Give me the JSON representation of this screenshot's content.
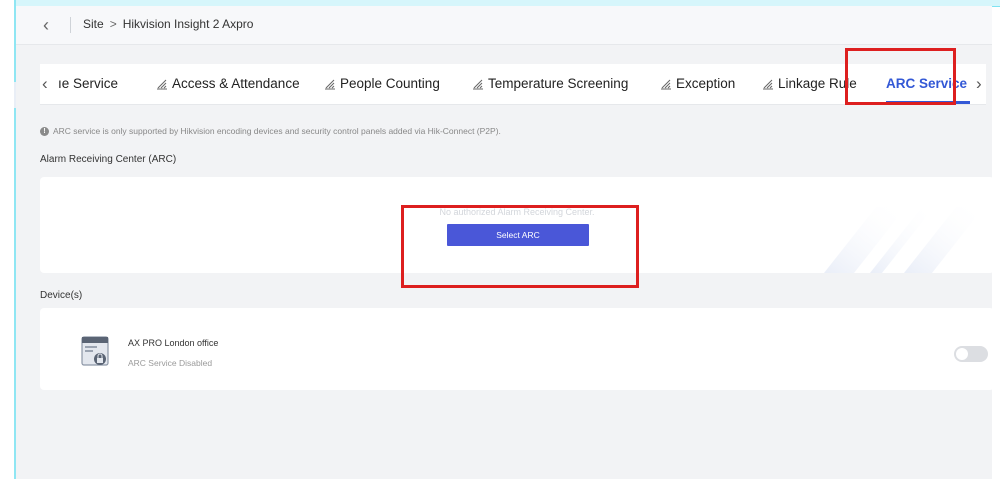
{
  "breadcrumb": {
    "site": "Site",
    "separator": ">",
    "current": "Hikvision Insight 2 Axpro"
  },
  "tabs": {
    "items": [
      {
        "label": "ıe Service"
      },
      {
        "label": "Access & Attendance",
        "icon": "chart-icon"
      },
      {
        "label": "People Counting",
        "icon": "chart-icon"
      },
      {
        "label": "Temperature Screening",
        "icon": "chart-icon"
      },
      {
        "label": "Exception",
        "icon": "chart-icon"
      },
      {
        "label": "Linkage Rule",
        "icon": "chart-icon"
      },
      {
        "label": "ARC Service",
        "active": true
      }
    ]
  },
  "info": {
    "text": "ARC service is only supported by Hikvision encoding devices and security control panels added via Hik-Connect (P2P)."
  },
  "arc": {
    "section_title": "Alarm Receiving Center (ARC)",
    "empty_text": "No authorized Alarm Receiving Center.",
    "button_label": "Select ARC"
  },
  "devices": {
    "section_title": "Device(s)",
    "items": [
      {
        "name": "AX PRO London office",
        "status": "ARC Service Disabled",
        "enabled": false
      }
    ]
  },
  "colors": {
    "accent": "#3358d6",
    "button": "#4a57d8",
    "highlight": "#dd1f1f"
  }
}
